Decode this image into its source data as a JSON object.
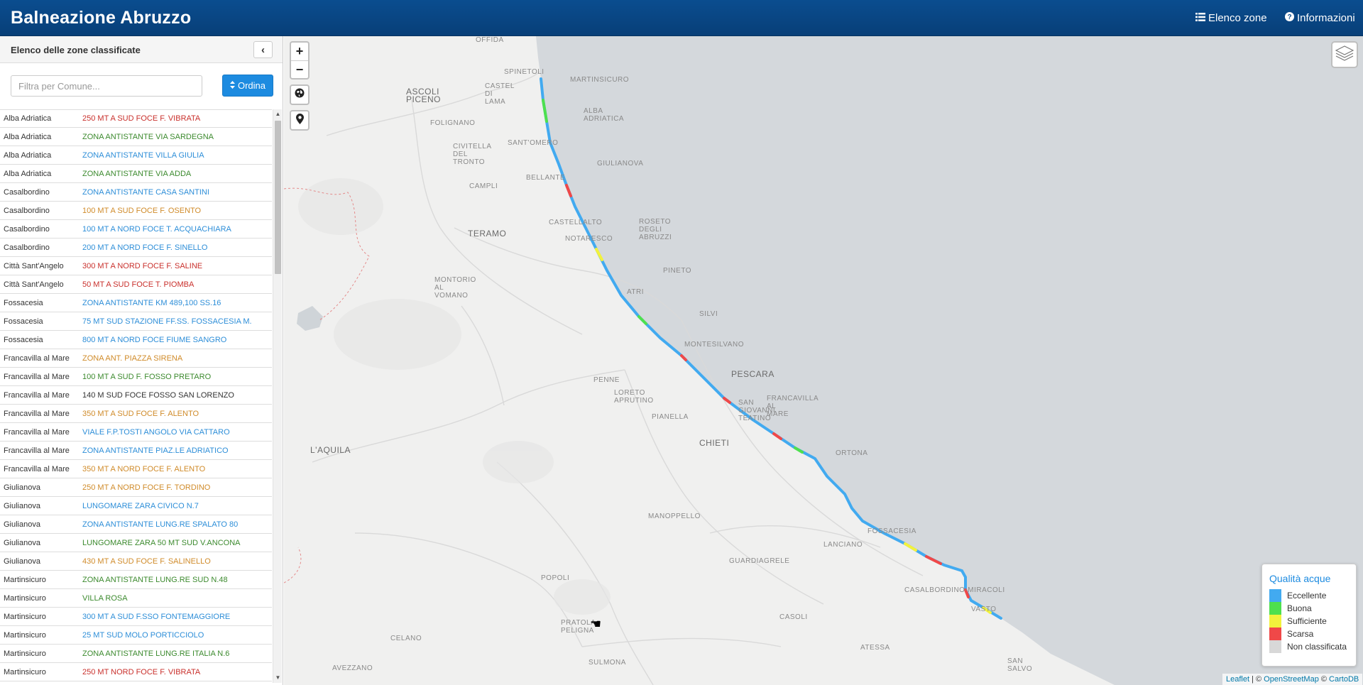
{
  "navbar": {
    "brand": "Balneazione Abruzzo",
    "zone_link": "Elenco zone",
    "info_link": "Informazioni"
  },
  "sidebar": {
    "title": "Elenco delle zone classificate",
    "filter_placeholder": "Filtra per Comune...",
    "sort_label": "Ordina",
    "zones": [
      {
        "comune": "Alba Adriatica",
        "zona": "250 MT A SUD FOCE F. VIBRATA",
        "color": "#c9302c"
      },
      {
        "comune": "Alba Adriatica",
        "zona": "ZONA ANTISTANTE VIA SARDEGNA",
        "color": "#3c8a2e"
      },
      {
        "comune": "Alba Adriatica",
        "zona": "ZONA ANTISTANTE VILLA GIULIA",
        "color": "#2d8ed8"
      },
      {
        "comune": "Alba Adriatica",
        "zona": "ZONA ANTISTANTE VIA ADDA",
        "color": "#3c8a2e"
      },
      {
        "comune": "Casalbordino",
        "zona": "ZONA ANTISTANTE CASA SANTINI",
        "color": "#2d8ed8"
      },
      {
        "comune": "Casalbordino",
        "zona": "100 MT A SUD FOCE F. OSENTO",
        "color": "#d08b2a"
      },
      {
        "comune": "Casalbordino",
        "zona": "100 MT A NORD FOCE T. ACQUACHIARA",
        "color": "#2d8ed8"
      },
      {
        "comune": "Casalbordino",
        "zona": "200 MT A NORD FOCE F. SINELLO",
        "color": "#2d8ed8"
      },
      {
        "comune": "Città Sant'Angelo",
        "zona": "300 MT A NORD FOCE F. SALINE",
        "color": "#c9302c"
      },
      {
        "comune": "Città Sant'Angelo",
        "zona": "50 MT A SUD FOCE T. PIOMBA",
        "color": "#c9302c"
      },
      {
        "comune": "Fossacesia",
        "zona": "ZONA ANTISTANTE KM 489,100 SS.16",
        "color": "#2d8ed8"
      },
      {
        "comune": "Fossacesia",
        "zona": "75 MT SUD STAZIONE FF.SS. FOSSACESIA M.",
        "color": "#2d8ed8"
      },
      {
        "comune": "Fossacesia",
        "zona": "800 MT A NORD FOCE FIUME SANGRO",
        "color": "#2d8ed8"
      },
      {
        "comune": "Francavilla al Mare",
        "zona": "ZONA ANT. PIAZZA SIRENA",
        "color": "#d08b2a"
      },
      {
        "comune": "Francavilla al Mare",
        "zona": "100 MT A SUD F. FOSSO PRETARO",
        "color": "#3c8a2e"
      },
      {
        "comune": "Francavilla al Mare",
        "zona": "140 M SUD FOCE FOSSO SAN LORENZO",
        "color": "#333333"
      },
      {
        "comune": "Francavilla al Mare",
        "zona": "350 MT A SUD FOCE F. ALENTO",
        "color": "#d08b2a"
      },
      {
        "comune": "Francavilla al Mare",
        "zona": "VIALE F.P.TOSTI ANGOLO VIA CATTARO",
        "color": "#2d8ed8"
      },
      {
        "comune": "Francavilla al Mare",
        "zona": "ZONA ANTISTANTE PIAZ.LE ADRIATICO",
        "color": "#2d8ed8"
      },
      {
        "comune": "Francavilla al Mare",
        "zona": "350 MT A NORD FOCE F. ALENTO",
        "color": "#d08b2a"
      },
      {
        "comune": "Giulianova",
        "zona": "250 MT A NORD FOCE F. TORDINO",
        "color": "#d08b2a"
      },
      {
        "comune": "Giulianova",
        "zona": "LUNGOMARE ZARA CIVICO N.7",
        "color": "#2d8ed8"
      },
      {
        "comune": "Giulianova",
        "zona": "ZONA ANTISTANTE LUNG.RE SPALATO 80",
        "color": "#2d8ed8"
      },
      {
        "comune": "Giulianova",
        "zona": "LUNGOMARE ZARA 50 MT SUD V.ANCONA",
        "color": "#3c8a2e"
      },
      {
        "comune": "Giulianova",
        "zona": "430 MT A SUD FOCE F. SALINELLO",
        "color": "#d08b2a"
      },
      {
        "comune": "Martinsicuro",
        "zona": "ZONA ANTISTANTE LUNG.RE SUD N.48",
        "color": "#3c8a2e"
      },
      {
        "comune": "Martinsicuro",
        "zona": "VILLA ROSA",
        "color": "#3c8a2e"
      },
      {
        "comune": "Martinsicuro",
        "zona": "300 MT A SUD F.SSO FONTEMAGGIORE",
        "color": "#2d8ed8"
      },
      {
        "comune": "Martinsicuro",
        "zona": "25 MT SUD MOLO PORTICCIOLO",
        "color": "#2d8ed8"
      },
      {
        "comune": "Martinsicuro",
        "zona": "ZONA ANTISTANTE LUNG.RE ITALIA N.6",
        "color": "#3c8a2e"
      },
      {
        "comune": "Martinsicuro",
        "zona": "250 MT NORD FOCE F. VIBRATA",
        "color": "#c9302c"
      }
    ]
  },
  "map": {
    "places": [
      {
        "name": "OFFIDA",
        "size": "small"
      },
      {
        "name": "SPINETOLI",
        "size": "small"
      },
      {
        "name": "ASCOLI PICENO",
        "size": "big"
      },
      {
        "name": "CASTEL DI LAMA",
        "size": "small"
      },
      {
        "name": "MARTINSICURO",
        "size": "small"
      },
      {
        "name": "ALBA ADRIATICA",
        "size": "small"
      },
      {
        "name": "FOLIGNANO",
        "size": "small"
      },
      {
        "name": "SANT'OMERO",
        "size": "small"
      },
      {
        "name": "CIVITELLA DEL TRONTO",
        "size": "small"
      },
      {
        "name": "GIULIANOVA",
        "size": "small"
      },
      {
        "name": "BELLANTE",
        "size": "small"
      },
      {
        "name": "CAMPLI",
        "size": "small"
      },
      {
        "name": "CASTELLALTO",
        "size": "small"
      },
      {
        "name": "ROSETO DEGLI ABRUZZI",
        "size": "small"
      },
      {
        "name": "TERAMO",
        "size": "big"
      },
      {
        "name": "NOTARESCO",
        "size": "small"
      },
      {
        "name": "PINETO",
        "size": "small"
      },
      {
        "name": "MONTORIO AL VOMANO",
        "size": "small"
      },
      {
        "name": "ATRI",
        "size": "small"
      },
      {
        "name": "SILVI",
        "size": "small"
      },
      {
        "name": "MONTESILVANO",
        "size": "small"
      },
      {
        "name": "PESCARA",
        "size": "big"
      },
      {
        "name": "PENNE",
        "size": "small"
      },
      {
        "name": "LORETO APRUTINO",
        "size": "small"
      },
      {
        "name": "FRANCAVILLA AL MARE",
        "size": "small"
      },
      {
        "name": "SAN GIOVANNI TEATINO",
        "size": "small"
      },
      {
        "name": "PIANELLA",
        "size": "small"
      },
      {
        "name": "L'AQUILA",
        "size": "big"
      },
      {
        "name": "CHIETI",
        "size": "big"
      },
      {
        "name": "ORTONA",
        "size": "small"
      },
      {
        "name": "MANOPPELLO",
        "size": "small"
      },
      {
        "name": "FOSSACESIA",
        "size": "small"
      },
      {
        "name": "LANCIANO",
        "size": "small"
      },
      {
        "name": "GUARDIAGRELE",
        "size": "small"
      },
      {
        "name": "CASALBORDINO-MIRACOLI",
        "size": "small"
      },
      {
        "name": "POPOLI",
        "size": "small"
      },
      {
        "name": "VASTO",
        "size": "small"
      },
      {
        "name": "CASOLI",
        "size": "small"
      },
      {
        "name": "CELANO",
        "size": "small"
      },
      {
        "name": "PRATOLA PELIGNA",
        "size": "small"
      },
      {
        "name": "ATESSA",
        "size": "small"
      },
      {
        "name": "AVEZZANO",
        "size": "small"
      },
      {
        "name": "SULMONA",
        "size": "small"
      },
      {
        "name": "SAN SALVO",
        "size": "small"
      }
    ],
    "legend": {
      "title": "Qualità acque",
      "items": [
        {
          "label": "Eccellente",
          "color": "#42aaf0"
        },
        {
          "label": "Buona",
          "color": "#4ee04e"
        },
        {
          "label": "Sufficiente",
          "color": "#f2f23c"
        },
        {
          "label": "Scarsa",
          "color": "#f04848"
        },
        {
          "label": "Non classificata",
          "color": "#d8d8d8"
        }
      ]
    },
    "attribution": {
      "leaflet": "Leaflet",
      "sep1": " | © ",
      "osm": "OpenStreetMap",
      "sep2": " © ",
      "carto": "CartoDB"
    },
    "zoom_in": "+",
    "zoom_out": "−"
  }
}
